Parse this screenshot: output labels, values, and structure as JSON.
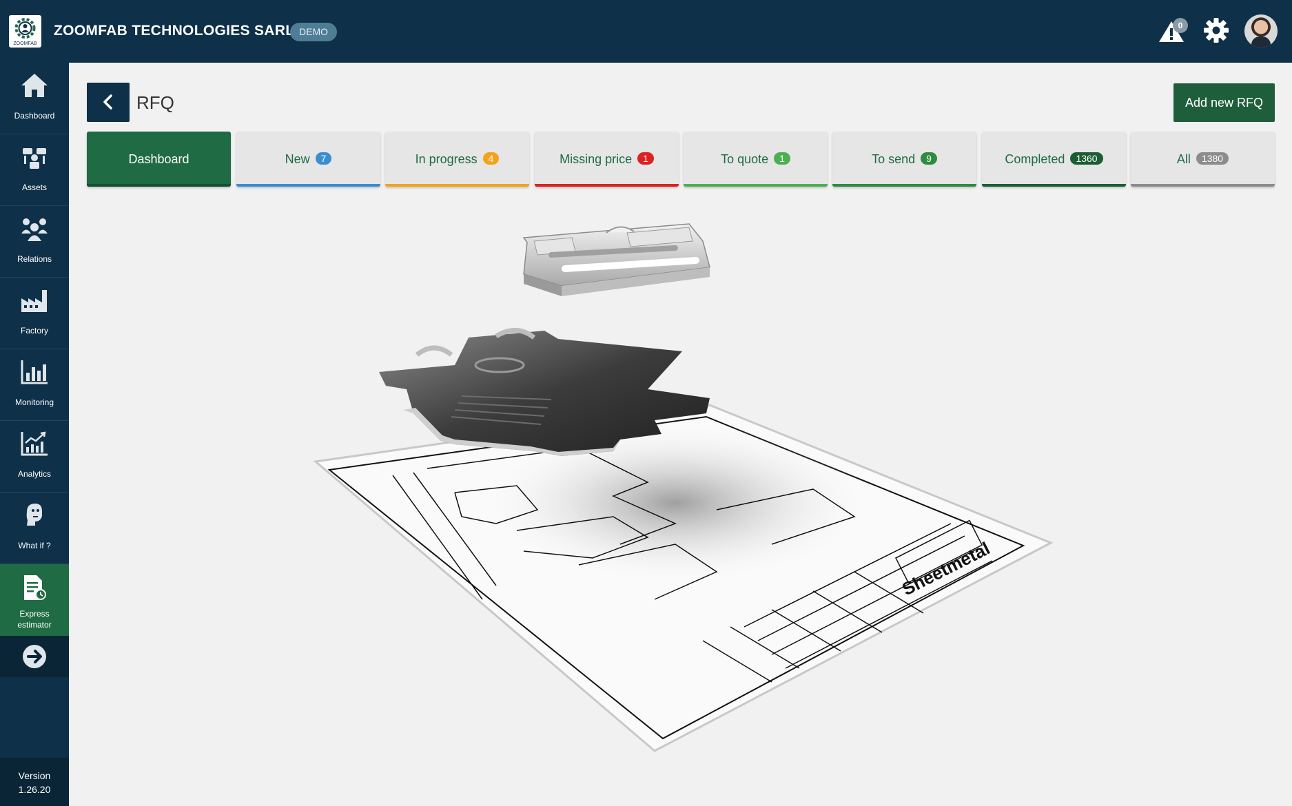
{
  "app": {
    "company": "ZOOMFAB TECHNOLOGIES SARL",
    "demo_badge": "DEMO",
    "logo_text": "ZOOMFAB",
    "notifications_count": "0"
  },
  "sidebar": {
    "items": [
      {
        "label": "Dashboard",
        "icon": "home-icon"
      },
      {
        "label": "Assets",
        "icon": "assets-icon"
      },
      {
        "label": "Relations",
        "icon": "relations-icon"
      },
      {
        "label": "Factory",
        "icon": "factory-icon"
      },
      {
        "label": "Monitoring",
        "icon": "bar-chart-icon"
      },
      {
        "label": "Analytics",
        "icon": "analytics-icon"
      },
      {
        "label": "What if ?",
        "icon": "thinking-person-icon"
      },
      {
        "label": "Express\nestimator",
        "label_line1": "Express",
        "label_line2": "estimator",
        "icon": "estimator-icon",
        "active": true
      }
    ],
    "collapse_icon": "arrow-right-circle-icon",
    "version_label": "Version",
    "version_number": "1.26.20"
  },
  "header": {
    "title": "RFQ",
    "add_button": "Add new RFQ"
  },
  "tabs": [
    {
      "label": "Dashboard",
      "active": true
    },
    {
      "label": "New",
      "count": "7",
      "color": "#3a8ed0"
    },
    {
      "label": "In progress",
      "count": "4",
      "color": "#f5a21b"
    },
    {
      "label": "Missing price",
      "count": "1",
      "color": "#e02020"
    },
    {
      "label": "To quote",
      "count": "1",
      "color": "#4caf50"
    },
    {
      "label": "To send",
      "count": "9",
      "color": "#2e8b3f"
    },
    {
      "label": "Completed",
      "count": "1360",
      "color": "#1b5e34"
    },
    {
      "label": "All",
      "count": "1380",
      "color": "#8c8c8c"
    }
  ],
  "illustration": {
    "drawing_label": "Sheetmetal"
  },
  "colors": {
    "topbar": "#0e3049",
    "accent_green": "#1f6b43",
    "add_button": "#1f5e3a"
  }
}
